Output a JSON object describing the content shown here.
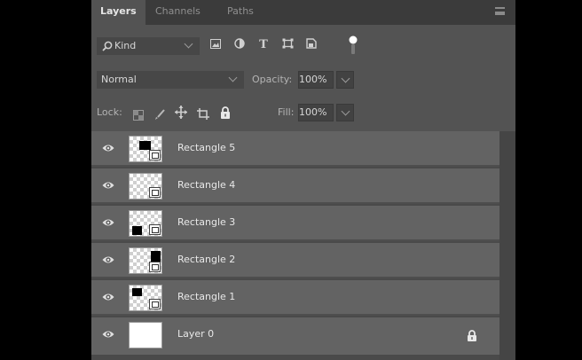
{
  "tabs": [
    "Layers",
    "Channels",
    "Paths"
  ],
  "filter": {
    "label": "Kind"
  },
  "blend": {
    "mode": "Normal",
    "opacity_label": "Opacity:",
    "opacity": "100%"
  },
  "lock": {
    "label": "Lock:",
    "fill_label": "Fill:",
    "fill": "100%"
  },
  "layers": [
    {
      "name": "Rectangle 5",
      "swatch": "top-left-center"
    },
    {
      "name": "Rectangle 4",
      "swatch": "none"
    },
    {
      "name": "Rectangle 3",
      "swatch": "bottom-left"
    },
    {
      "name": "Rectangle 2",
      "swatch": "top-right"
    },
    {
      "name": "Rectangle 1",
      "swatch": "top-left"
    },
    {
      "name": "Layer 0",
      "swatch": "plain",
      "locked": true
    }
  ]
}
